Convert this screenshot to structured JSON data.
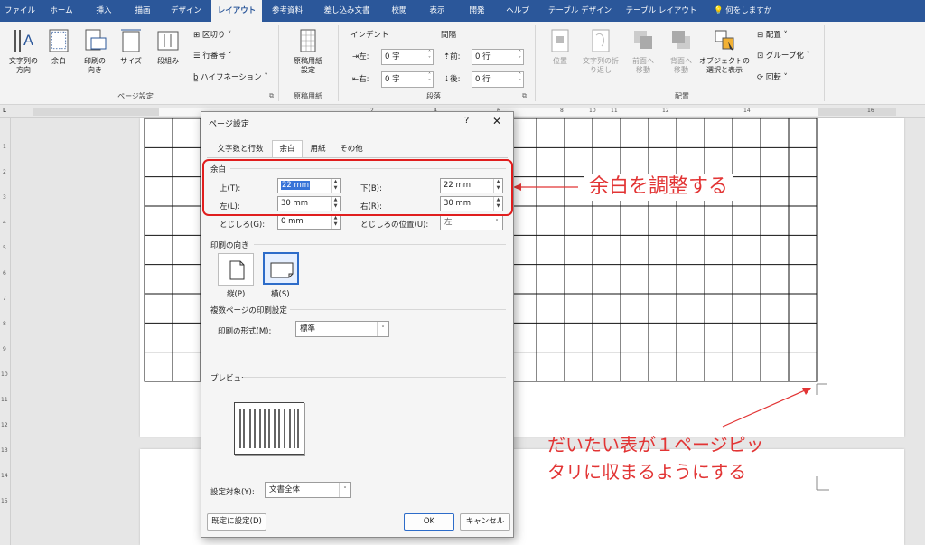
{
  "ribbon_tabs": [
    {
      "label": "ファイル"
    },
    {
      "label": "ホーム"
    },
    {
      "label": "挿入"
    },
    {
      "label": "描画"
    },
    {
      "label": "デザイン"
    },
    {
      "label": "レイアウト"
    },
    {
      "label": "参考資料"
    },
    {
      "label": "差し込み文書"
    },
    {
      "label": "校閲"
    },
    {
      "label": "表示"
    },
    {
      "label": "開発"
    },
    {
      "label": "ヘルプ"
    },
    {
      "label": "テーブル デザイン"
    },
    {
      "label": "テーブル レイアウト"
    }
  ],
  "active_tab": "レイアウト",
  "tell_me": "何をしますか",
  "page_setup_group": {
    "label": "ページ設定",
    "text_direction": "文字列の\n方向",
    "margins": "余白",
    "orientation": "印刷の\n向き",
    "size": "サイズ",
    "columns": "段組み",
    "breaks": "区切り",
    "line_numbers": "行番号",
    "hyphenation": "ハイフネーション"
  },
  "genko_group": {
    "label": "原稿用紙",
    "button": "原稿用紙\n設定"
  },
  "paragraph_group": {
    "label": "段落",
    "indent_title": "インデント",
    "spacing_title": "間隔",
    "left_label": "左:",
    "left_value": "0 字",
    "right_label": "右:",
    "right_value": "0 字",
    "before_label": "前:",
    "before_value": "0 行",
    "after_label": "後:",
    "after_value": "0 行"
  },
  "arrange_group": {
    "label": "配置",
    "position": "位置",
    "wrap_text": "文字列の折\nり返し",
    "bring_forward": "前面へ\n移動",
    "send_backward": "背面へ\n移動",
    "selection_pane": "オブジェクトの\n選択と表示",
    "align": "配置",
    "group": "グループ化",
    "rotate": "回転"
  },
  "ruler_numbers": [
    "2",
    "4",
    "6",
    "8",
    "10",
    "11",
    "12",
    "14",
    "16"
  ],
  "vruler_numbers": [
    "1",
    "2",
    "3",
    "4",
    "5",
    "6",
    "7",
    "8",
    "9",
    "10",
    "11",
    "12",
    "13",
    "14",
    "15"
  ],
  "dialog": {
    "title": "ページ設定",
    "help": "?",
    "close": "✕",
    "tabs": [
      {
        "label": "文字数と行数"
      },
      {
        "label": "余白"
      },
      {
        "label": "用紙"
      },
      {
        "label": "その他"
      }
    ],
    "active_tab": "余白",
    "margins_section": "余白",
    "top_label": "上(T):",
    "top_value": "22 mm",
    "bottom_label": "下(B):",
    "bottom_value": "22 mm",
    "left_label": "左(L):",
    "left_value": "30 mm",
    "right_label": "右(R):",
    "right_value": "30 mm",
    "gutter_label": "とじしろ(G):",
    "gutter_value": "0 mm",
    "gutter_pos_label": "とじしろの位置(U):",
    "gutter_pos_value": "左",
    "orientation_section": "印刷の向き",
    "portrait": "縦(P)",
    "landscape": "横(S)",
    "multi_section": "複数ページの印刷設定",
    "multi_label": "印刷の形式(M):",
    "multi_value": "標準",
    "preview_section": "プレビュー",
    "apply_label": "設定対象(Y):",
    "apply_value": "文書全体",
    "default_button": "既定に設定(D)",
    "ok_button": "OK",
    "cancel_button": "キャンセル"
  },
  "annotations": {
    "adjust_margins": "余白を調整する",
    "fit_table_line1": "だいたい表が１ページピッ",
    "fit_table_line2": "タリに収まるようにする"
  },
  "colors": {
    "accent": "#2b579a",
    "annotation": "#e23434"
  }
}
